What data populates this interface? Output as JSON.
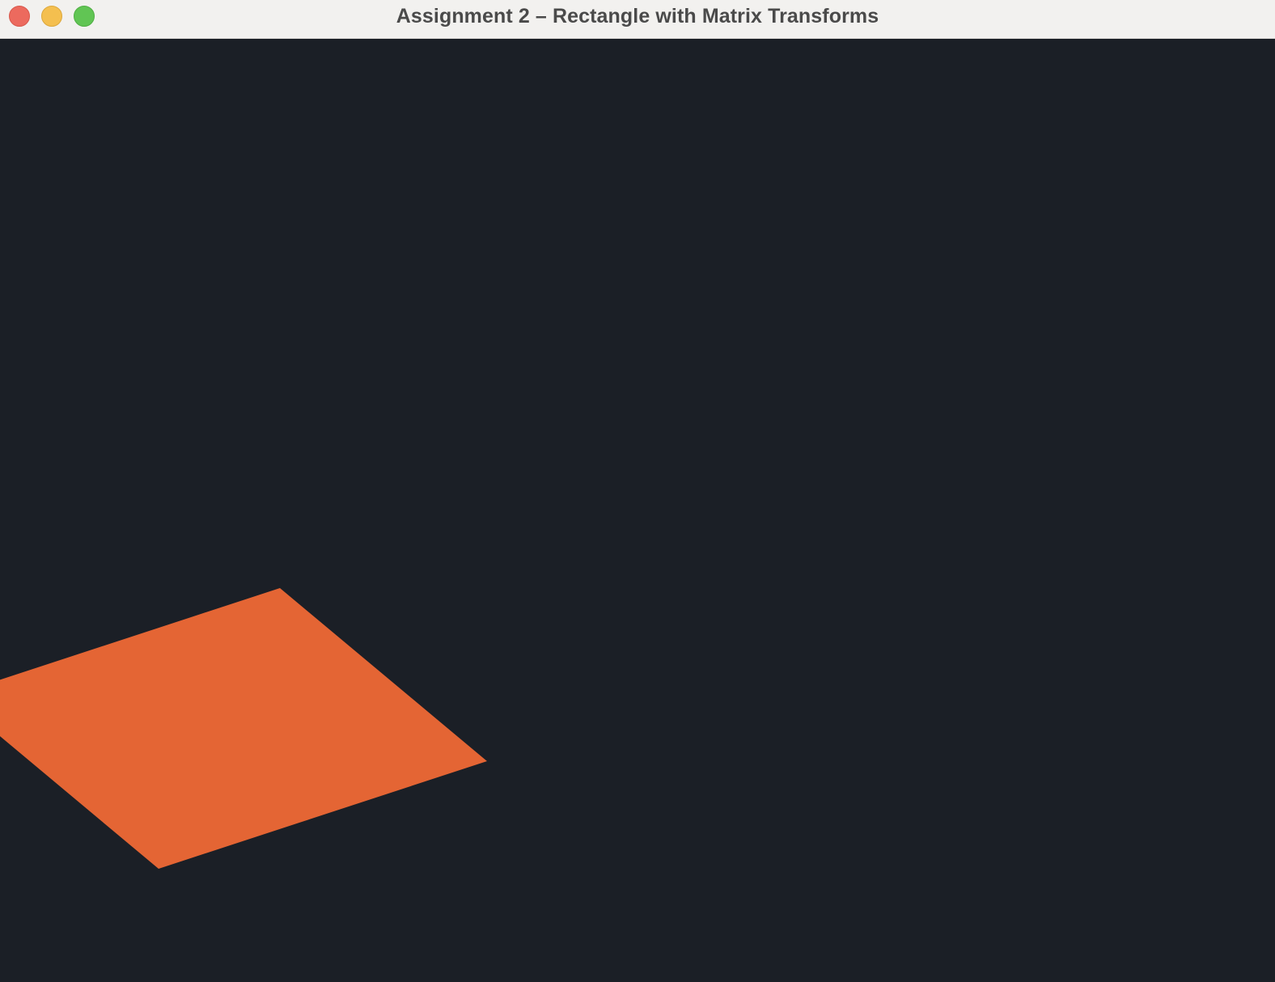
{
  "window": {
    "title": "Assignment 2 – Rectangle with Matrix Transforms",
    "background_color": "#1b1f26"
  },
  "titlebar": {
    "buttons": [
      {
        "name": "close",
        "color": "#ec6a5e"
      },
      {
        "name": "minimize",
        "color": "#f4bf4f"
      },
      {
        "name": "zoom",
        "color": "#61c554"
      }
    ]
  },
  "scene": {
    "shape": "rectangle",
    "fill_color": "#e46534"
  }
}
